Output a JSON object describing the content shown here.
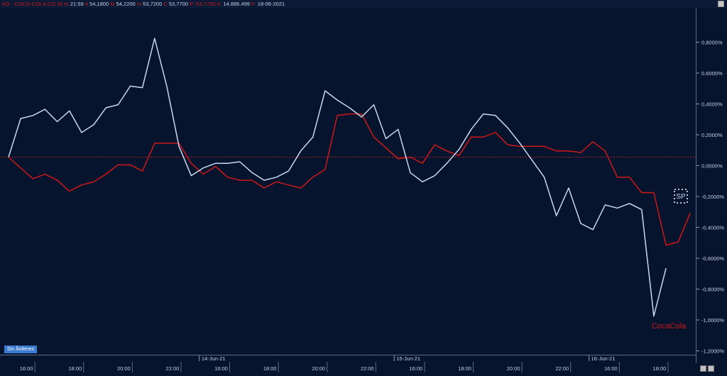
{
  "header": {
    "ticker": "KO - COCA-COLA CO",
    "interval": "30 m",
    "time": "21:59",
    "open_label": "A",
    "open": "54,1800",
    "high_label": "M",
    "high": "54,2200",
    "low_label": "m",
    "low": "53,7200",
    "close_label": "C",
    "close": "53,7700",
    "change": "P: 53,7700",
    "volume_label": "V:",
    "volume": "14.886.499",
    "date_label": "F:",
    "date": "18-06-2021"
  },
  "orders_badge": "Sin Ãrdenes",
  "sp_label": "SP",
  "colors": {
    "background": "#06142e",
    "cocacola": "#d01818",
    "sp": "#c8d8ee",
    "zero_line": "#b02020",
    "axis_text": "#c8d0e0"
  },
  "chart_data": {
    "type": "line",
    "y_unit": "%",
    "ylim": [
      -1.3,
      1.0
    ],
    "y_ticks": [
      "0,8000%",
      "0,6000%",
      "0,4000%",
      "0,2000%",
      "0,0000%",
      "-0,2000%",
      "-0,4000%",
      "-0,6000%",
      "-0,8000%",
      "-1,0000%",
      "-1,2000%"
    ],
    "y_tick_values": [
      0.8,
      0.6,
      0.4,
      0.2,
      0.0,
      -0.2,
      -0.4,
      -0.6,
      -0.8,
      -1.0,
      -1.2
    ],
    "x_tick_labels": [
      "16:00",
      "18:00",
      "20:00",
      "22:00",
      "16:00",
      "18:00",
      "20:00",
      "22:00",
      "16:00",
      "18:00",
      "20:00",
      "22:00",
      "16:00",
      "18:00",
      "20:00"
    ],
    "x_tick_index": [
      1,
      5,
      9,
      13,
      17,
      21,
      25,
      29,
      33,
      37,
      41,
      45,
      49,
      53,
      57
    ],
    "date_labels": [
      "14-Jun-21",
      "15-Jun-21",
      "16-Jun-21"
    ],
    "date_label_index": [
      15.5,
      31.5,
      47.5
    ],
    "grid": false,
    "series": [
      {
        "name": "CocaCola",
        "values": [
          0.0,
          0.25,
          0.27,
          0.31,
          0.23,
          0.3,
          0.16,
          0.21,
          0.32,
          0.34,
          0.46,
          0.45,
          0.77,
          0.46,
          0.07,
          -0.12,
          -0.07,
          -0.04,
          -0.04,
          -0.03,
          -0.1,
          -0.15,
          -0.13,
          -0.09,
          0.04,
          0.13,
          0.43,
          0.37,
          0.32,
          0.26,
          0.34,
          0.12,
          0.18,
          -0.1,
          -0.16,
          -0.12,
          -0.04,
          0.05,
          0.18,
          0.28,
          0.27,
          0.19,
          0.09,
          -0.02,
          -0.13,
          -0.38,
          -0.2,
          -0.43,
          -0.47,
          -0.31,
          -0.33,
          -0.3,
          -0.34,
          -1.03,
          -0.72
        ]
      },
      {
        "name": "SP",
        "values": [
          0.0,
          -0.07,
          -0.14,
          -0.11,
          -0.15,
          -0.22,
          -0.18,
          -0.16,
          -0.11,
          -0.05,
          -0.05,
          -0.09,
          0.09,
          0.09,
          0.09,
          -0.04,
          -0.11,
          -0.06,
          -0.13,
          -0.15,
          -0.15,
          -0.2,
          -0.16,
          -0.18,
          -0.2,
          -0.13,
          -0.08,
          0.27,
          0.28,
          0.28,
          0.13,
          0.06,
          -0.01,
          0.0,
          -0.04,
          0.08,
          0.04,
          0.01,
          0.13,
          0.13,
          0.16,
          0.08,
          0.07,
          0.07,
          0.07,
          0.04,
          0.04,
          0.03,
          0.1,
          0.04,
          -0.13,
          -0.13,
          -0.23,
          -0.23,
          -0.57,
          -0.55,
          -0.36
        ]
      }
    ]
  }
}
